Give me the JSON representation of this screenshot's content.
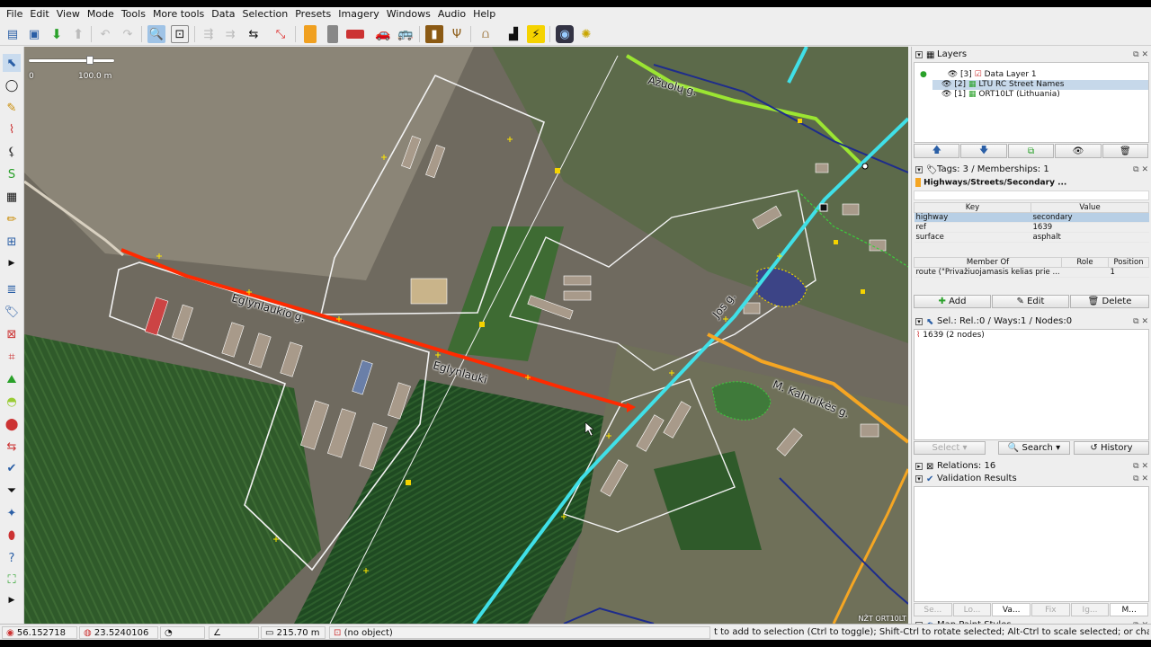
{
  "menubar": {
    "items": [
      "File",
      "Edit",
      "View",
      "Mode",
      "Tools",
      "More tools",
      "Data",
      "Selection",
      "Presets",
      "Imagery",
      "Windows",
      "Audio",
      "Help"
    ]
  },
  "toolbar": {
    "icons": [
      "open-icon",
      "save-icon",
      "download-icon",
      "upload-icon",
      "undo-icon",
      "redo-icon",
      "zoom-icon",
      "preferences-icon",
      "split-way-icon",
      "combine-way-icon",
      "reverse-way-icon",
      "orthogonalize-icon",
      "preset-tower-icon",
      "preset-traffic-light-icon",
      "preset-barrier-icon",
      "preset-car-icon",
      "preset-bus-icon",
      "preset-hydrant-icon",
      "preset-restaurant-icon",
      "preset-bridge-icon",
      "preset-industrial-icon",
      "preset-power-icon",
      "imagery-offset-icon",
      "plugin-icon"
    ]
  },
  "map": {
    "scale_start": "0",
    "scale_end": "100.0 m",
    "attribution": "NŽT ORT10LT",
    "street_labels": [
      "Ažuolų g.",
      "Eglynlaukio g.",
      "Eglynlauki",
      "M. Kalnuikės g.",
      "Jos g."
    ]
  },
  "layers": {
    "title": "Layers",
    "items": [
      {
        "index": "[3]",
        "name": "Data Layer 1",
        "active": true
      },
      {
        "index": "[2]",
        "name": "LTU RC Street Names",
        "active": false
      },
      {
        "index": "[1]",
        "name": "ORT10LT (Lithuania)",
        "active": false
      }
    ]
  },
  "tags": {
    "title": "Tags: 3 / Memberships: 1",
    "preset": "Highways/Streets/Secondary ...",
    "key_header": "Key",
    "value_header": "Value",
    "rows": [
      {
        "key": "highway",
        "value": "secondary"
      },
      {
        "key": "ref",
        "value": "1639"
      },
      {
        "key": "surface",
        "value": "asphalt"
      }
    ],
    "member_header": "Member Of",
    "role_header": "Role",
    "position_header": "Position",
    "memberships": [
      {
        "member": "route (\"Privažiuojamasis kelias prie ...",
        "role": "",
        "position": "1"
      }
    ],
    "add_label": "Add",
    "edit_label": "Edit",
    "delete_label": "Delete"
  },
  "selection": {
    "title": "Sel.: Rel.:0 / Ways:1 / Nodes:0",
    "items": [
      "1639 (2 nodes)"
    ],
    "select_label": "Select",
    "search_label": "Search",
    "history_label": "History"
  },
  "relations": {
    "title": "Relations: 16"
  },
  "validation": {
    "title": "Validation Results"
  },
  "bottom_tabs": [
    "Se...",
    "Lo...",
    "Va...",
    "Fix",
    "Ig...",
    "M..."
  ],
  "mapstyles": {
    "title": "Map Paint Styles"
  },
  "status": {
    "lat": "56.152718",
    "lon": "23.5240106",
    "distance": "215.70 m",
    "object": "(no object)",
    "hint": "t to add to selection (Ctrl to toggle); Shift-Ctrl to rotate selected; Alt-Ctrl to scale selected; or change selection"
  },
  "colors": {
    "selected_way": "#ff2a00",
    "trunk": "#40e0e8",
    "primary": "#f5a623",
    "tertiary": "#b7f542",
    "boundary": "#f2f2f2"
  }
}
